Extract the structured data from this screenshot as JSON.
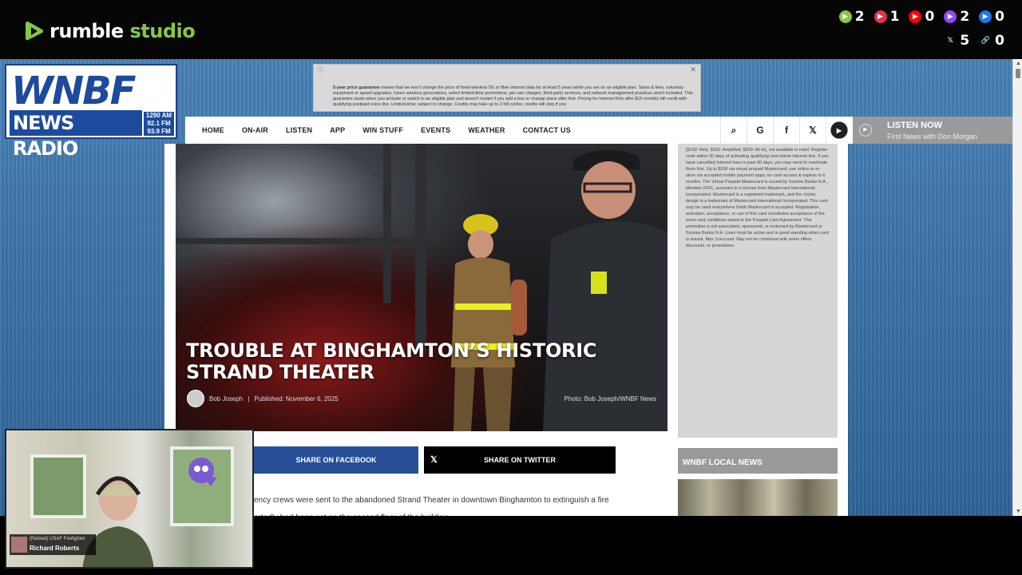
{
  "studio": {
    "brand_rumble": "rumble",
    "brand_studio": " studio",
    "counts_row1": [
      {
        "icon": "rumble-icon",
        "color": "#85c742",
        "value": "2"
      },
      {
        "icon": "rumble-alt-icon",
        "color": "#e0334c",
        "value": "1"
      },
      {
        "icon": "youtube-icon",
        "color": "#ff0000",
        "value": "0"
      },
      {
        "icon": "twitch-icon",
        "color": "#9146ff",
        "value": "2"
      },
      {
        "icon": "facebook-icon",
        "color": "#1877f2",
        "value": "0"
      }
    ],
    "counts_row2": [
      {
        "icon": "x-icon",
        "color": "#ffffff",
        "value": "5"
      },
      {
        "icon": "link-icon",
        "color": "#85c742",
        "value": "0"
      }
    ]
  },
  "site": {
    "logo": {
      "line1": "WNBF",
      "line2": "NEWS RADIO",
      "freq1": "1290 AM",
      "freq2": "92.1 FM",
      "freq3": "93.9 FM"
    },
    "ad_banner": {
      "text_bold": "5-year price guarantee",
      "text": " means that we won't change the price of fixed-wireless 5G or fiber internet data for at least 5 years while you are on an eligible plan. Taxes & fees, voluntary equipment or speed upgrades, future wireless generations, select limited-time promotions, per-use charges, third-party services, and network management practices aren't included. This guarantee starts when you activate or switch to an eligible plan and doesn't restart if you add a line or change plans after that. Pricing for Internet Rely after $15 monthly bill credit with qualifying postpaid voice line. Limited-time; subject to change. Credits may take up to 2 bill cycles; credits will stop if you"
    },
    "nav": [
      "HOME",
      "ON-AIR",
      "LISTEN",
      "APP",
      "WIN STUFF",
      "EVENTS",
      "WEATHER",
      "CONTACT US"
    ],
    "nav_icons": [
      {
        "name": "search-icon",
        "glyph": "⌕"
      },
      {
        "name": "google-icon",
        "glyph": "G"
      },
      {
        "name": "facebook-icon",
        "glyph": "f"
      },
      {
        "name": "x-icon",
        "glyph": "𝕏"
      },
      {
        "name": "youtube-icon",
        "glyph": "▶"
      }
    ],
    "listen_now": {
      "title": "LISTEN NOW",
      "subtitle": "First News with Don Morgan"
    },
    "article": {
      "title": "TROUBLE AT BINGHAMTON’S HISTORIC STRAND THEATER",
      "author": "Bob Joseph",
      "published": "Published: November 6, 2025",
      "photo_credit": "Photo: Bob Joseph/WNBF News",
      "share_facebook": "SHARE ON FACEBOOK",
      "share_twitter": "SHARE ON TWITTER",
      "body_line1": "ency crews were sent to the abandoned Strand Theater in downtown Binghamton to extinguish a fire",
      "body_line2": "ortedly had been set on the second floor of the building."
    },
    "side_ad_text": "[$100: Rely; $150: Amplified; $200: All-In], not available in retail. Register code within 30 days of activating qualifying new Home Internet line. If you have cancelled Internet lines in past 90 days, you may need to reactivate them first. Up to $200 via virtual prepaid Mastercard; use online or in-store via accepted mobile payment apps; no cash access & expires in 6 months. The Virtual Prepaid Mastercard is issued by Sunrise Banks N.A., Member FDIC, pursuant to a license from Mastercard International Incorporated. Mastercard is a registered trademark, and the circles design is a trademark of Mastercard International Incorporated. This card may be used everywhere Debit Mastercard is accepted. Registration, activation, acceptance, or use of this card constitutes acceptance of the terms and conditions stated in the Prepaid Card Agreement. This promotion is not associated, sponsored, or endorsed by Mastercard or Sunrise Banks N.A. Lines must be active and in good standing when card is issued. Max 1/account. May not be combined with some offers, discounts, or promotions.",
    "local_news": "WNBF LOCAL NEWS"
  },
  "webcam": {
    "role": "(Retired) USAF Firefighter",
    "name": "Richard Roberts"
  }
}
